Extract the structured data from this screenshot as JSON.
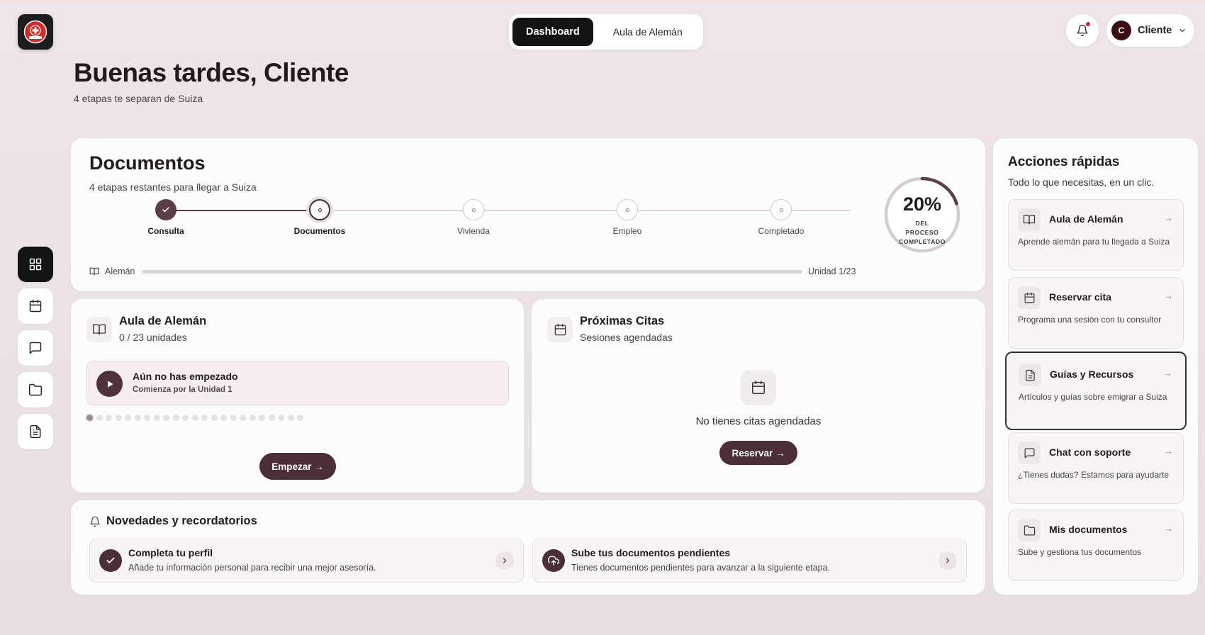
{
  "header": {
    "tabs": [
      {
        "label": "Dashboard",
        "active": true
      },
      {
        "label": "Aula de Alemán",
        "active": false
      }
    ],
    "user": {
      "initial": "C",
      "name": "Cliente"
    }
  },
  "greeting": {
    "title": "Buenas tardes, Cliente",
    "subtitle": "4 etapas te separan de Suiza"
  },
  "sidebar": {
    "items": [
      {
        "name": "dashboard",
        "icon": "grid-icon",
        "active": true
      },
      {
        "name": "calendar",
        "icon": "calendar-icon",
        "active": false
      },
      {
        "name": "messages",
        "icon": "chat-icon",
        "active": false
      },
      {
        "name": "folders",
        "icon": "folder-icon",
        "active": false
      },
      {
        "name": "documents",
        "icon": "document-icon",
        "active": false
      }
    ]
  },
  "progress": {
    "title": "Documentos",
    "subtitle": "4 etapas restantes para llegar a Suiza",
    "steps": [
      {
        "label": "Consulta",
        "state": "done"
      },
      {
        "label": "Documentos",
        "state": "current"
      },
      {
        "label": "Vivienda",
        "state": "pending"
      },
      {
        "label": "Empleo",
        "state": "pending"
      },
      {
        "label": "Completado",
        "state": "pending"
      }
    ],
    "percent": 20,
    "percent_label": "20%",
    "percent_caption": "DEL PROCESO COMPLETADO",
    "german_label": "Alemán",
    "german_unit": "Unidad 1/23",
    "german_progress": 0
  },
  "aula": {
    "title": "Aula de Alemán",
    "subtitle": "0 / 23 unidades",
    "status_title": "Aún no has empezado",
    "status_sub": "Comienza por la Unidad 1",
    "total_units": 23,
    "completed_units": 0,
    "button": "Empezar →"
  },
  "citas": {
    "title": "Próximas Citas",
    "subtitle": "Sesiones agendadas",
    "empty_text": "No tienes citas agendadas",
    "button": "Reservar →"
  },
  "news": {
    "title": "Novedades y recordatorios",
    "items": [
      {
        "icon": "check-icon",
        "title": "Completa tu perfil",
        "sub": "Añade tu información personal para recibir una mejor asesoría."
      },
      {
        "icon": "upload-cloud-icon",
        "title": "Sube tus documentos pendientes",
        "sub": "Tienes documentos pendientes para avanzar a la siguiente etapa."
      }
    ]
  },
  "quick_actions": {
    "title": "Acciones rápidas",
    "subtitle": "Todo lo que necesitas, en un clic.",
    "items": [
      {
        "icon": "book-icon",
        "title": "Aula de Alemán",
        "desc": "Aprende alemán para tu llegada a Suiza",
        "arrow": "→"
      },
      {
        "icon": "calendar-icon",
        "title": "Reservar cita",
        "desc": "Programa una sesión con tu consultor",
        "arrow": "→"
      },
      {
        "icon": "document-icon",
        "title": "Guías y Recursos",
        "desc": "Artículos y guías sobre emigrar a Suiza",
        "arrow": "→",
        "selected": true
      },
      {
        "icon": "chat-icon",
        "title": "Chat con soporte",
        "desc": "¿Tienes dudas? Estamos para ayudarte",
        "arrow": "→"
      },
      {
        "icon": "folder-icon",
        "title": "Mis documentos",
        "desc": "Sube y gestiona tus documentos",
        "arrow": "→"
      }
    ]
  },
  "colors": {
    "accent": "#4a2f38",
    "nav_active": "#141414",
    "notification": "#d6263b"
  }
}
